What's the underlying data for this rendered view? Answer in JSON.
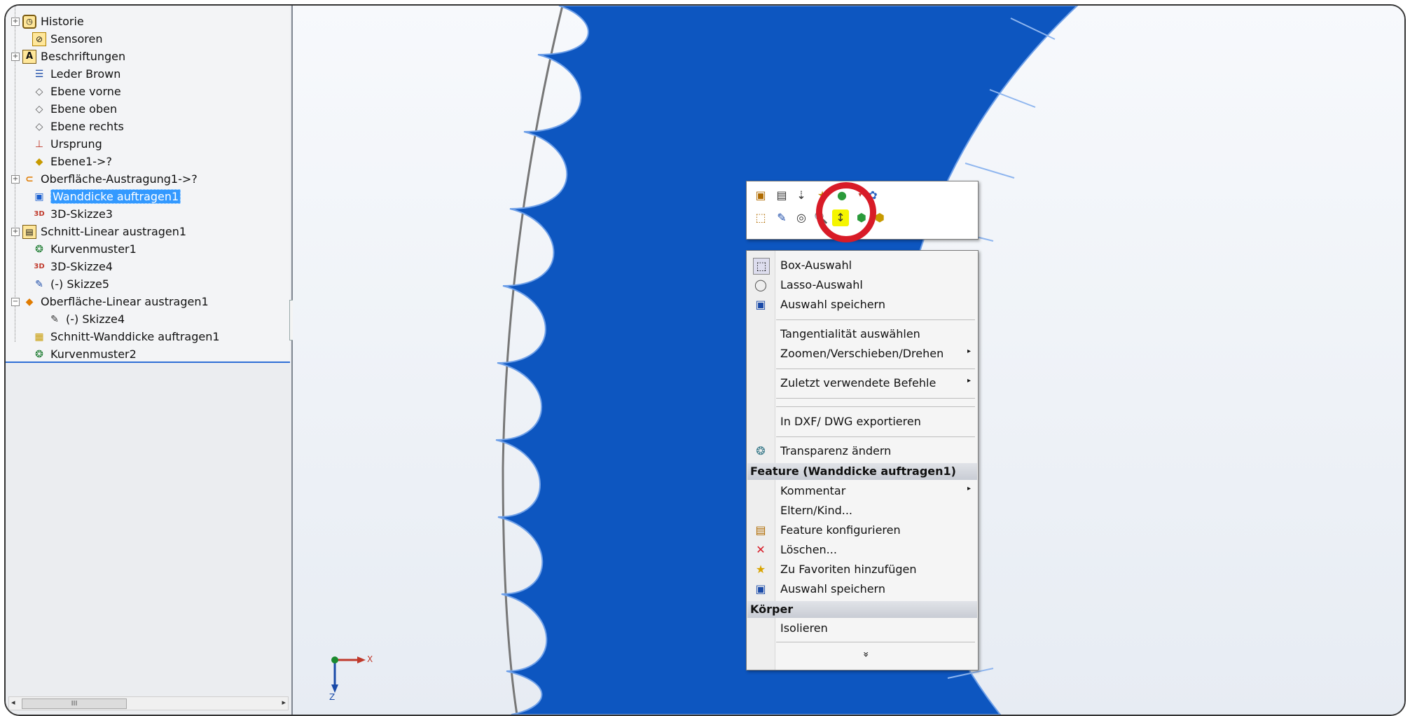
{
  "feature_tree": {
    "items": [
      {
        "label": "Historie",
        "icon": "history-icon",
        "expander": "+"
      },
      {
        "label": "Sensoren",
        "icon": "sensor-icon",
        "expander": ""
      },
      {
        "label": "Beschriftungen",
        "icon": "annotation-icon",
        "expander": "+"
      },
      {
        "label": "Leder Brown",
        "icon": "material-icon",
        "expander": ""
      },
      {
        "label": "Ebene vorne",
        "icon": "plane-icon",
        "expander": ""
      },
      {
        "label": "Ebene oben",
        "icon": "plane-icon",
        "expander": ""
      },
      {
        "label": "Ebene rechts",
        "icon": "plane-icon",
        "expander": ""
      },
      {
        "label": "Ursprung",
        "icon": "origin-icon",
        "expander": ""
      },
      {
        "label": "Ebene1->?",
        "icon": "plane-warning-icon",
        "expander": ""
      },
      {
        "label": "Oberfläche-Austragung1->?",
        "icon": "surface-sweep-icon",
        "expander": "+"
      },
      {
        "label": "Wanddicke auftragen1",
        "icon": "thicken-icon",
        "expander": "",
        "selected": true
      },
      {
        "label": "3D-Skizze3",
        "icon": "3d-sketch-icon",
        "expander": ""
      },
      {
        "label": "Schnitt-Linear austragen1",
        "icon": "cut-extrude-icon",
        "expander": "+"
      },
      {
        "label": "Kurvenmuster1",
        "icon": "curve-pattern-icon",
        "expander": ""
      },
      {
        "label": "3D-Skizze4",
        "icon": "3d-sketch-icon",
        "expander": ""
      },
      {
        "label": "(-) Skizze5",
        "icon": "sketch-icon",
        "expander": ""
      },
      {
        "label": "Oberfläche-Linear austragen1",
        "icon": "surface-extrude-icon",
        "expander": "-"
      },
      {
        "label": "(-) Skizze4",
        "icon": "sketch-icon",
        "expander": "",
        "child": true
      },
      {
        "label": "Schnitt-Wanddicke auftragen1",
        "icon": "cut-thicken-icon",
        "expander": ""
      },
      {
        "label": "Kurvenmuster2",
        "icon": "curve-pattern-icon",
        "expander": ""
      }
    ],
    "scroll_thumb": "III"
  },
  "context_menu": {
    "items": [
      {
        "label": "Box-Auswahl",
        "icon": "box-select-icon",
        "submenu": false
      },
      {
        "label": "Lasso-Auswahl",
        "icon": "lasso-icon",
        "submenu": false
      },
      {
        "label": "Auswahl speichern",
        "icon": "save-selection-icon",
        "submenu": false
      },
      {
        "label": "Tangentialität auswählen",
        "icon": "",
        "submenu": false
      },
      {
        "label": "Zoomen/Verschieben/Drehen",
        "icon": "",
        "submenu": true
      },
      {
        "label": "Zuletzt verwendete Befehle",
        "icon": "",
        "submenu": true
      },
      {
        "label": "In DXF/ DWG exportieren",
        "icon": "",
        "submenu": false
      },
      {
        "label": "Transparenz ändern",
        "icon": "transparency-icon",
        "submenu": false
      },
      {
        "label": "Kommentar",
        "icon": "",
        "submenu": true
      },
      {
        "label": "Eltern/Kind...",
        "icon": "",
        "submenu": false
      },
      {
        "label": "Feature konfigurieren",
        "icon": "configure-icon",
        "submenu": false
      },
      {
        "label": "Löschen...",
        "icon": "delete-icon",
        "submenu": false
      },
      {
        "label": "Zu Favoriten hinzufügen",
        "icon": "favorites-icon",
        "submenu": false
      },
      {
        "label": "Auswahl speichern",
        "icon": "save-selection-icon",
        "submenu": false
      },
      {
        "label": "Isolieren",
        "icon": "",
        "submenu": false
      }
    ],
    "section_feature": "Feature (Wanddicke auftragen1)",
    "section_body": "Körper",
    "more_glyph": "»"
  },
  "triad": {
    "x_label": "X",
    "z_label": "Z"
  },
  "colors": {
    "body_blue": "#0d56c0",
    "highlight": "#f5f500",
    "annotation_circle": "#d81b27",
    "selection": "#3399ff"
  }
}
